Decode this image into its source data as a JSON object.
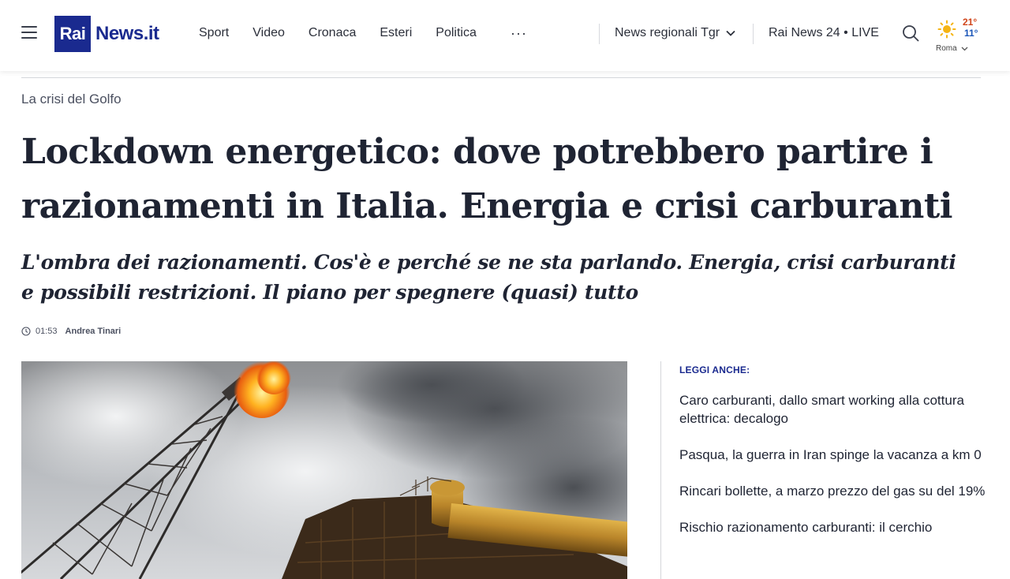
{
  "header": {
    "logo_rai": "Rai",
    "logo_news": "News.it",
    "nav": [
      "Sport",
      "Video",
      "Cronaca",
      "Esteri",
      "Politica"
    ],
    "more": "···",
    "regional": "News regionali Tgr",
    "live": "Rai News 24 • LIVE",
    "weather": {
      "high": "21°",
      "low": "11°",
      "city": "Roma"
    }
  },
  "article": {
    "kicker": "La crisi del Golfo",
    "title": "Lockdown energetico: dove potrebbero partire i razionamenti in Italia. Energia e crisi carburanti",
    "subtitle": "L'ombra dei razionamenti. Cos'è e perché se ne sta parlando. Energia, crisi carburanti e possibili restrizioni. Il piano per spegnere (quasi) tutto",
    "time": "01:53",
    "author": "Andrea Tinari"
  },
  "related": {
    "label": "LEGGI ANCHE:",
    "items": [
      "Caro carburanti, dallo smart working alla cottura elettrica: decalogo",
      "Pasqua, la guerra in Iran spinge la vacanza a km 0",
      "Rincari bollette, a marzo prezzo del gas su del 19%",
      "Rischio razionamento carburanti: il cerchio"
    ]
  },
  "colors": {
    "brand": "#1a2a8f",
    "text": "#1f2433",
    "temp_high": "#d0451b",
    "temp_low": "#1a55b8"
  },
  "icons": [
    "menu-icon",
    "chevron-down-icon",
    "search-icon",
    "sun-icon",
    "clock-icon"
  ]
}
